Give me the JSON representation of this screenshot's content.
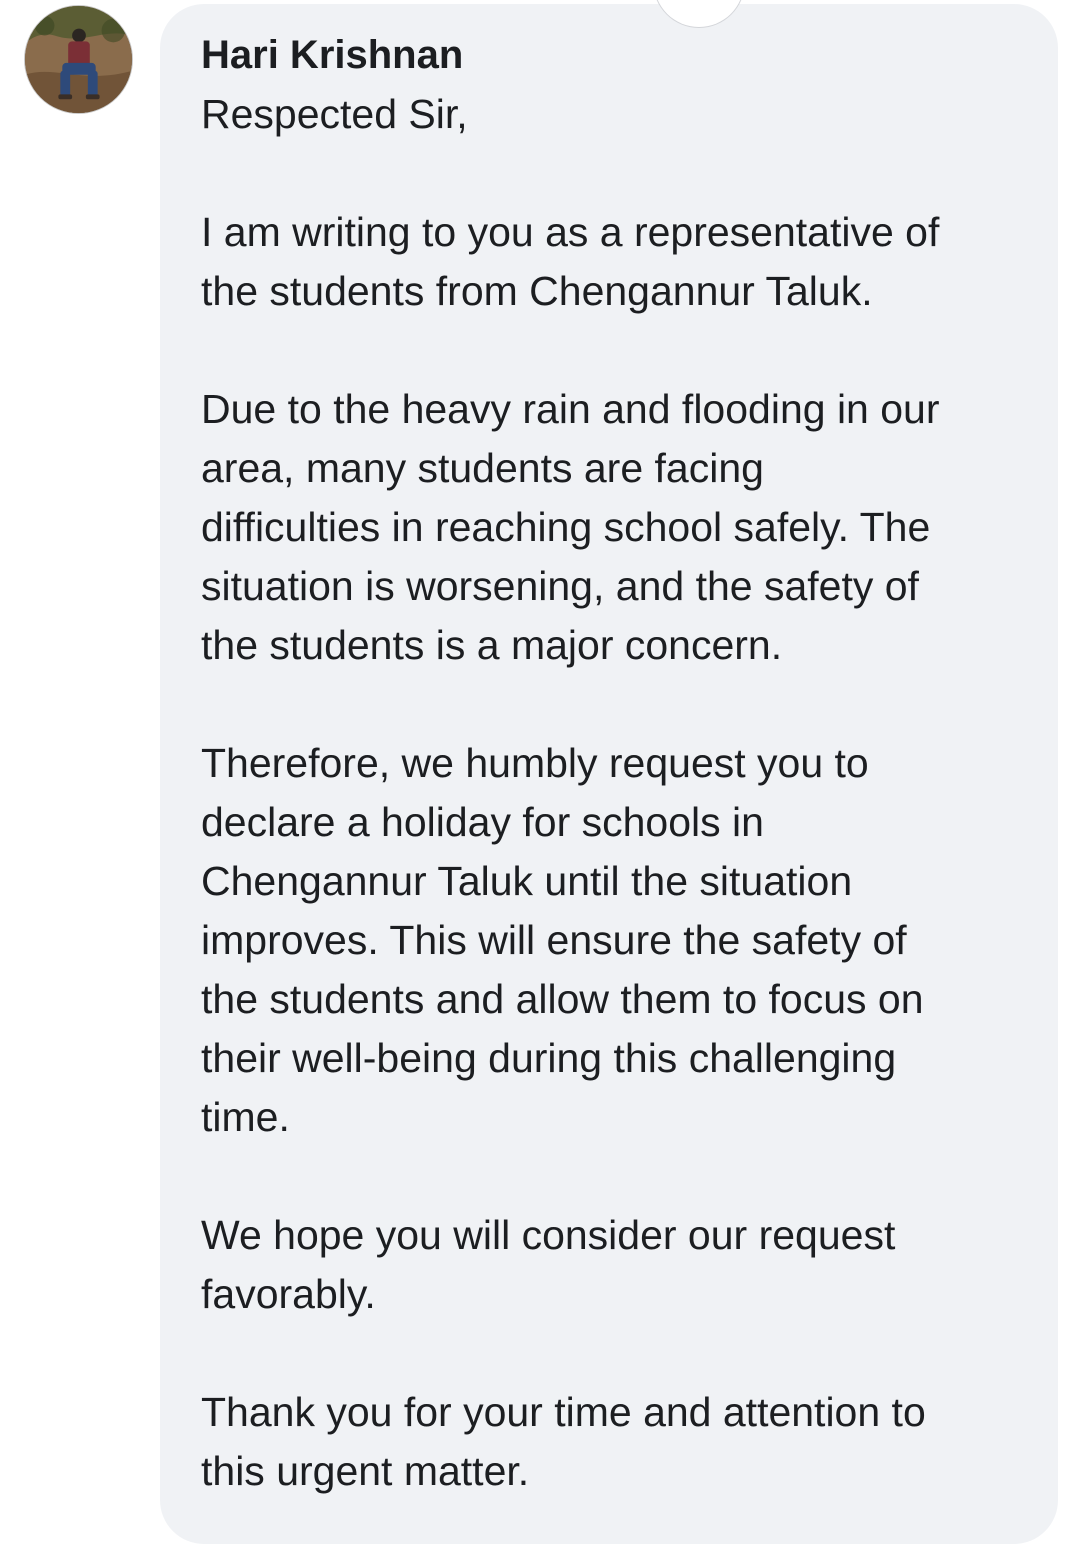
{
  "comment": {
    "author": "Hari Krishnan",
    "greeting": "Respected Sir,",
    "paragraphs": [
      "I am writing to you as a representative of\nthe students from Chengannur Taluk.",
      "Due to the heavy rain and flooding in our\narea, many students are facing\ndifficulties in reaching school safely. The\nsituation is worsening, and the safety of\nthe students is a major concern.",
      "Therefore, we humbly request you to\ndeclare a holiday for schools in\nChengannur Taluk until the situation\nimproves. This will ensure the safety of\nthe students and allow them to focus on\ntheir well-being during this challenging\ntime.",
      "We hope you will consider our request\nfavorably.",
      "Thank you for your time and attention to\nthis urgent matter."
    ]
  },
  "colors": {
    "bubble_background": "#f0f2f5",
    "text": "#1c1e21"
  },
  "icons": {
    "avatar": "profile-photo"
  }
}
